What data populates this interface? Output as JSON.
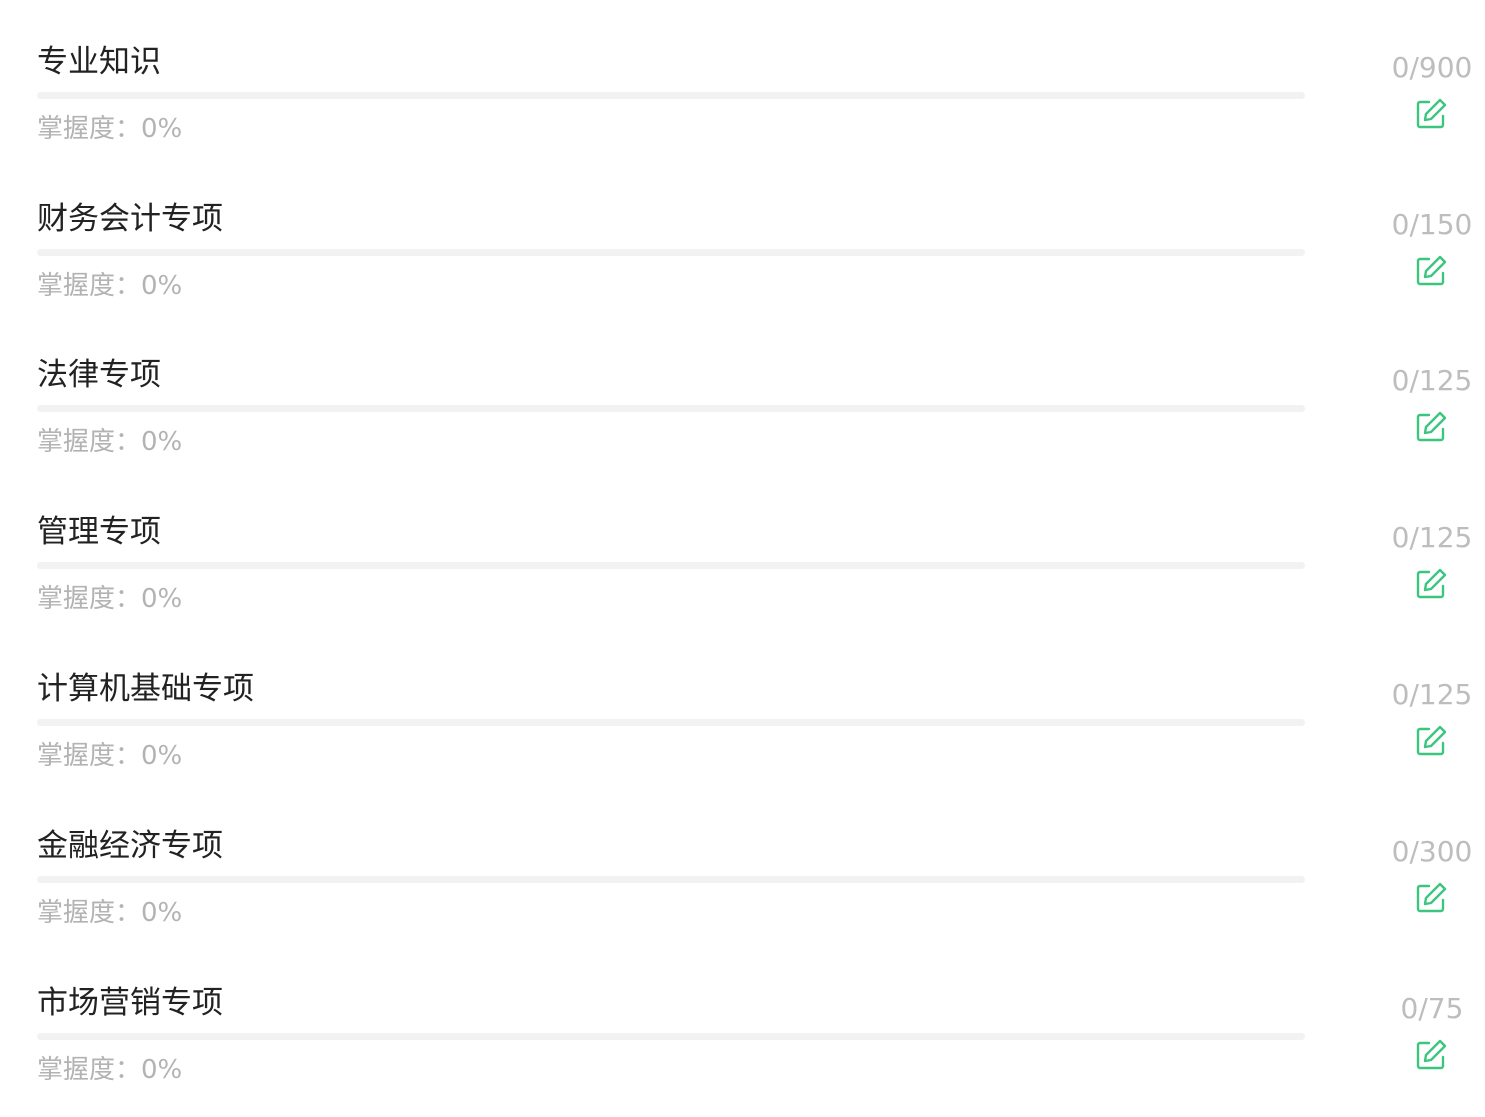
{
  "colors": {
    "accent": "#3cc57f",
    "title_text": "#222222",
    "muted_text": "#b3b3b3",
    "track": "#f2f2f2"
  },
  "items": [
    {
      "title": "专业知识",
      "mastery": "掌握度：0%",
      "count": "0/900",
      "progress": 0,
      "icon": "edit-icon"
    },
    {
      "title": "财务会计专项",
      "mastery": "掌握度：0%",
      "count": "0/150",
      "progress": 0,
      "icon": "edit-icon"
    },
    {
      "title": "法律专项",
      "mastery": "掌握度：0%",
      "count": "0/125",
      "progress": 0,
      "icon": "edit-icon"
    },
    {
      "title": "管理专项",
      "mastery": "掌握度：0%",
      "count": "0/125",
      "progress": 0,
      "icon": "edit-icon"
    },
    {
      "title": "计算机基础专项",
      "mastery": "掌握度：0%",
      "count": "0/125",
      "progress": 0,
      "icon": "edit-icon"
    },
    {
      "title": "金融经济专项",
      "mastery": "掌握度：0%",
      "count": "0/300",
      "progress": 0,
      "icon": "edit-icon"
    },
    {
      "title": "市场营销专项",
      "mastery": "掌握度：0%",
      "count": "0/75",
      "progress": 0,
      "icon": "edit-icon"
    }
  ]
}
